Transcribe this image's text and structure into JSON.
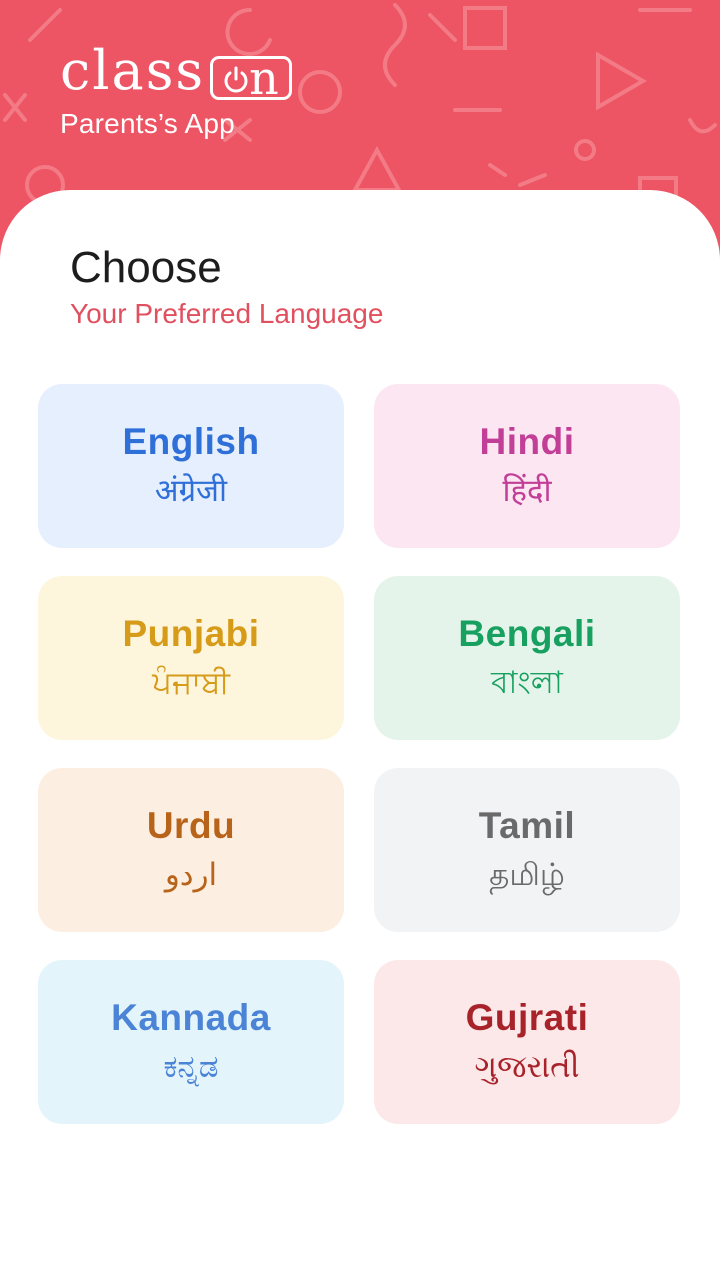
{
  "header": {
    "logo_text": "class",
    "logo_on_text": "n",
    "tagline": "Parents’s App",
    "background": "#ed5464"
  },
  "page": {
    "title": "Choose",
    "subtitle": "Your Preferred Language"
  },
  "languages": [
    {
      "name": "English",
      "native": "अंग्रेजी",
      "color": "#2f6fd8",
      "background": "#e6effd"
    },
    {
      "name": "Hindi",
      "native": "हिंदी",
      "color": "#c23f97",
      "background": "#fce6f2"
    },
    {
      "name": "Punjabi",
      "native": "ਪੰਜਾਬੀ",
      "color": "#d79b1a",
      "background": "#fdf6dc"
    },
    {
      "name": "Bengali",
      "native": "বাংলা",
      "color": "#17a05f",
      "background": "#e5f4ea"
    },
    {
      "name": "Urdu",
      "native": "اردو",
      "color": "#b8631a",
      "background": "#fdeee2"
    },
    {
      "name": "Tamil",
      "native": "தமிழ்",
      "color": "#6a6a6a",
      "background": "#f1f3f5"
    },
    {
      "name": "Kannada",
      "native": "ಕನ್ನಡ",
      "color": "#4b84d6",
      "background": "#e3f4fb"
    },
    {
      "name": "Gujrati",
      "native": "ગુજરાતી",
      "color": "#a8222a",
      "background": "#fce8e8"
    }
  ]
}
